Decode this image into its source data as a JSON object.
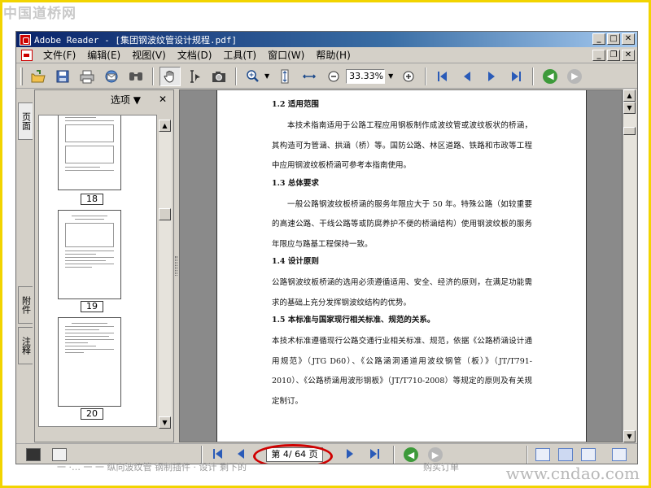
{
  "watermark_top": "中国道桥网",
  "watermark_bottom": "www.cndao.com",
  "bg_snippet_left": "一 ·… 一 一 纵向波纹管  钢制插件 · 设计 剩下的",
  "bg_snippet_right": "购买订单",
  "window": {
    "title": "Adobe Reader - [集团钢波纹管设计规程.pdf]",
    "buttons": {
      "minimize": "_",
      "maximize": "□",
      "close": "✕",
      "restore": "❐"
    }
  },
  "menu": {
    "items": [
      {
        "label": "文件(F)"
      },
      {
        "label": "编辑(E)"
      },
      {
        "label": "视图(V)"
      },
      {
        "label": "文档(D)"
      },
      {
        "label": "工具(T)"
      },
      {
        "label": "窗口(W)"
      },
      {
        "label": "帮助(H)"
      }
    ]
  },
  "toolbar": {
    "zoom_value": "33.33%",
    "icons": [
      "open-icon",
      "save-icon",
      "print-icon",
      "email-icon",
      "search-icon",
      "hand-tool-icon",
      "select-text-icon",
      "snapshot-icon",
      "zoom-in-tool-icon",
      "fit-page-icon",
      "fit-width-icon",
      "zoom-out-icon",
      "zoom-plus-icon",
      "first-page-icon",
      "prev-page-icon",
      "next-page-icon",
      "last-page-icon",
      "back-icon",
      "forward-icon"
    ]
  },
  "side_tabs": {
    "pages": "页面",
    "attachments": "附件",
    "comments": "注释"
  },
  "pages_panel": {
    "options_label": "选项 ▼",
    "close_label": "✕",
    "thumbnails": [
      {
        "page": "18"
      },
      {
        "page": "19"
      },
      {
        "page": "20"
      }
    ]
  },
  "document": {
    "sections": [
      {
        "heading": "1.2 适用范围",
        "paragraphs": [
          "本技术指南适用于公路工程应用钢板制作成波纹管或波纹板状的桥涵，其构造可为管涵、拱涵（桥）等。国防公路、林区道路、铁路和市政等工程中应用钢波纹板桥涵可参考本指南使用。"
        ]
      },
      {
        "heading": "1.3 总体要求",
        "paragraphs": [
          "一般公路钢波纹板桥涵的服务年限应大于 50 年。特殊公路（如较重要的高速公路、干线公路等或防腐养护不便的桥涵结构）使用钢波纹板的服务年限应与路基工程保持一致。"
        ]
      },
      {
        "heading": "1.4 设计原则",
        "paragraphs": [
          "公路钢波纹板桥涵的选用必须遵循适用、安全、经济的原则，在满足功能需求的基础上充分发挥钢波纹结构的优势。"
        ]
      },
      {
        "heading": "1.5 本标准与国家现行相关标准、规范的关系。",
        "paragraphs": [
          "本技术标准遵循现行公路交通行业相关标准、规范，依据《公路桥涵设计通用规范》（JTG D60）、《公路涵洞通道用波纹钢管（板）》（JT/T791-2010）、《公路桥涵用波形钢板》（JT/T710-2008）等规定的原则及有关规定制订。"
        ]
      }
    ]
  },
  "status": {
    "page_indicator": "第 4/ 64 页",
    "highlight_color": "#d00000"
  }
}
